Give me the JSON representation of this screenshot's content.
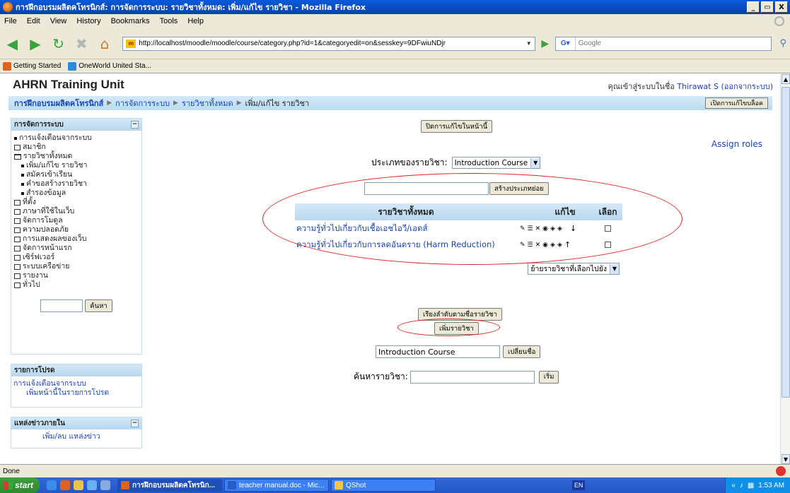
{
  "window": {
    "title": "การฝึกอบรมผลิตคโทรนิกส์: การจัดการระบบ: รายวิชาทั้งหมด: เพิ่ม/แก้ไข รายวิชา - Mozilla Firefox",
    "minimize": "_",
    "restore": "▭",
    "close": "X"
  },
  "menu": [
    "File",
    "Edit",
    "View",
    "History",
    "Bookmarks",
    "Tools",
    "Help"
  ],
  "url": "http://localhost/moodle/moodle/course/category.php?id=1&categoryedit=on&sesskey=9DFwiuNDjr",
  "search_placeholder": "Google",
  "bookmarks": [
    {
      "label": "Getting Started",
      "icon": "firefox-icon",
      "color": "#e0621d"
    },
    {
      "label": "OneWorld United Sta...",
      "icon": "oneworld-icon",
      "color": "#2a8bd6"
    }
  ],
  "site": {
    "name": "AHRN Training Unit",
    "login_prefix": "คุณเข้าสู่ระบบในชื่อ",
    "user": "Thirawat S",
    "logout": "(ออกจากระบบ)"
  },
  "breadcrumb": [
    "การฝึกอบรมผลิตคโทรนิกส์",
    "การจัดการระบบ",
    "รายวิชาทั้งหมด",
    "เพิ่ม/แก้ไข รายวิชา"
  ],
  "blocks_editing_button": "เปิดการแก้ไขบล็อค",
  "admin_block": {
    "title": "การจัดการระบบ",
    "items": [
      {
        "label": "การแจ้งเตือนจากระบบ",
        "type": "bullet",
        "indent": 0
      },
      {
        "label": "สมาชิก",
        "type": "folder",
        "indent": 0
      },
      {
        "label": "รายวิชาทั้งหมด",
        "type": "open",
        "indent": 0
      },
      {
        "label": "เพิ่ม/แก้ไข รายวิชา",
        "type": "bullet",
        "indent": 1
      },
      {
        "label": "สมัครเข้าเรียน",
        "type": "bullet",
        "indent": 1
      },
      {
        "label": "คำขอสร้างรายวิชา",
        "type": "bullet",
        "indent": 1
      },
      {
        "label": "สำรองข้อมูล",
        "type": "bullet",
        "indent": 1
      },
      {
        "label": "ที่ตั้ง",
        "type": "folder",
        "indent": 0
      },
      {
        "label": "ภาษาที่ใช้ในเว็บ",
        "type": "folder",
        "indent": 0
      },
      {
        "label": "จัดการโมดูล",
        "type": "folder",
        "indent": 0
      },
      {
        "label": "ความปลอดภัย",
        "type": "folder",
        "indent": 0
      },
      {
        "label": "การแสดงผลของเว็บ",
        "type": "folder",
        "indent": 0
      },
      {
        "label": "จัดการหน้าแรก",
        "type": "folder",
        "indent": 0
      },
      {
        "label": "เซิร์ฟเวอร์",
        "type": "folder",
        "indent": 0
      },
      {
        "label": "ระบบเครือข่าย",
        "type": "folder",
        "indent": 0
      },
      {
        "label": "รายงาน",
        "type": "folder",
        "indent": 0
      },
      {
        "label": "ทั่วไป",
        "type": "folder",
        "indent": 0
      }
    ],
    "search_button": "ค้นหา"
  },
  "favorites_block": {
    "title": "รายการโปรด",
    "link1": "การแจ้งเตือนจากระบบ",
    "link2": "เพิ่มหน้านี้ในรายการโปรด"
  },
  "news_block": {
    "title": "แหล่งข่าวภายใน",
    "link": "เพิ่ม/ลบ แหล่งข่าว"
  },
  "main": {
    "turn_editing_off": "ปิดการแก้ไขในหน้านี้",
    "assign_roles": "Assign roles",
    "category_label": "ประเภทของรายวิชา:",
    "category_value": "Introduction Course",
    "create_subcategory": "สร้างประเภทย่อย",
    "table_headers": [
      "รายวิชาทั้งหมด",
      "แก้ไข",
      "เลือก"
    ],
    "courses": [
      {
        "name": "ความรู้ทั่วไปเกี่ยวกับเชื้อเอชไอวี/เอดส์",
        "arrow": "↓"
      },
      {
        "name": "ความรู้ทั่วไปเกี่ยวกับการลดอันตราย (Harm Reduction)",
        "arrow": "↑"
      }
    ],
    "move_selected": "ย้ายรายวิชาที่เลือกไปยัง",
    "sort_button": "เรียงลำดับตามชื่อรายวิชา",
    "add_course": "เพิ่มรายวิชา",
    "rename_value": "Introduction Course",
    "rename_button": "เปลี่ยนชื่อ",
    "search_label": "ค้นหารายวิชา:",
    "search_button": "เริ่ม"
  },
  "status": "Done",
  "taskbar": {
    "start": "start",
    "tasks": [
      {
        "label": "การฝึกอบรมผลิตคโทรนิก...",
        "active": true
      },
      {
        "label": "teacher manual.doc - Mic...",
        "active": false
      },
      {
        "label": "QShot",
        "active": false
      }
    ],
    "lang": "EN",
    "time": "1:53 AM"
  }
}
